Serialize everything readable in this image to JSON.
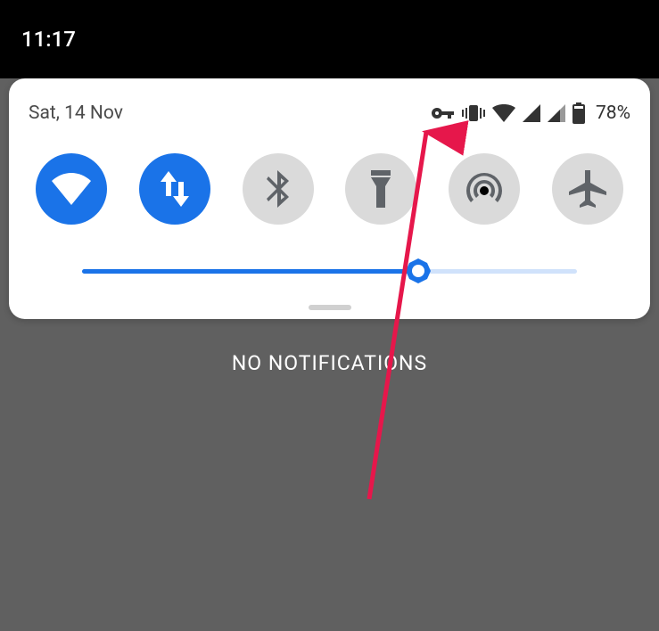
{
  "status_bar": {
    "time": "11:17"
  },
  "panel": {
    "date": "Sat, 14 Nov",
    "battery_percent": "78%"
  },
  "status_icons": {
    "vpn": "vpn-key-icon",
    "vibrate": "vibrate-icon",
    "wifi": "wifi-icon",
    "signal1": "signal-icon",
    "signal2": "signal-icon",
    "battery": "battery-icon"
  },
  "tiles": [
    {
      "name": "wifi-tile",
      "icon": "wifi",
      "active": true
    },
    {
      "name": "mobile-data-tile",
      "icon": "data",
      "active": true
    },
    {
      "name": "bluetooth-tile",
      "icon": "bluetooth",
      "active": false
    },
    {
      "name": "flashlight-tile",
      "icon": "flashlight",
      "active": false
    },
    {
      "name": "hotspot-tile",
      "icon": "hotspot",
      "active": false
    },
    {
      "name": "airplane-tile",
      "icon": "airplane",
      "active": false
    }
  ],
  "brightness": {
    "value": 68
  },
  "notifications": {
    "empty_text": "NO NOTIFICATIONS"
  },
  "annotation": {
    "color": "#e6174b"
  }
}
